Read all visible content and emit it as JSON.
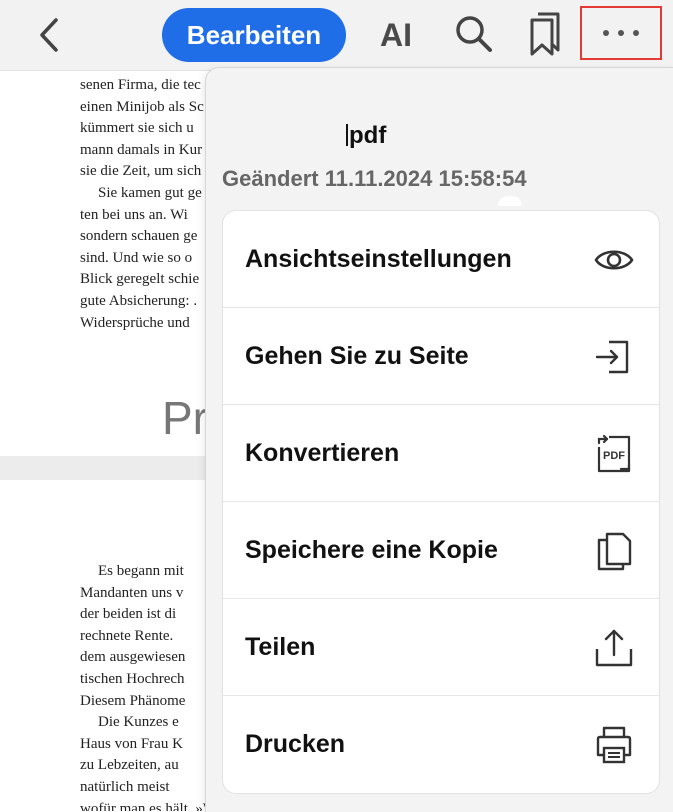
{
  "toolbar": {
    "edit_label": "Bearbeiten",
    "ai_label": "AI",
    "icons": {
      "back": "chevron-left-icon",
      "search": "search-icon",
      "bookmarks": "bookmarks-icon",
      "more": "more-horizontal-icon"
    },
    "accent_color": "#1f6ee8",
    "highlight_color": "#e53935"
  },
  "document": {
    "page1_lines": [
      "senen Firma, die tec",
      "einen Minijob als Sc",
      "kümmert sie sich u",
      "mann damals in Kur",
      "sie die Zeit, um sich",
      "Sie kamen gut ge",
      "ten bei uns an. Wi",
      "sondern schauen ge",
      "sind. Und wie so o",
      "Blick geregelt schie",
      "gute Absicherung: .",
      "Widersprüche und"
    ],
    "heading_fragment": "Pr",
    "page2_lines": [
      "Es begann mit",
      "Mandanten uns v",
      "der beiden ist di",
      "rechnete Rente.",
      "dem ausgewiesen",
      "tischen Hochrech",
      "Diesem Phänome",
      "Die Kunzes e",
      "Haus von Frau K",
      "zu Lebzeiten, au",
      "natürlich meist",
      "wofür man es hält. »Wo steht das Haus denn?«, fragten wir vorsichtig nach."
    ]
  },
  "menu": {
    "file_name": "pdf",
    "modified": "Geändert 11.11.2024 15:58:54",
    "items": [
      {
        "label": "Ansichtseinstellungen",
        "icon": "eye-icon"
      },
      {
        "label": "Gehen Sie zu Seite",
        "icon": "go-to-page-icon"
      },
      {
        "label": "Konvertieren",
        "icon": "pdf-convert-icon",
        "icon_text": "PDF"
      },
      {
        "label": "Speichere eine Kopie",
        "icon": "copy-icon"
      },
      {
        "label": "Teilen",
        "icon": "share-icon"
      },
      {
        "label": "Drucken",
        "icon": "printer-icon"
      }
    ]
  }
}
